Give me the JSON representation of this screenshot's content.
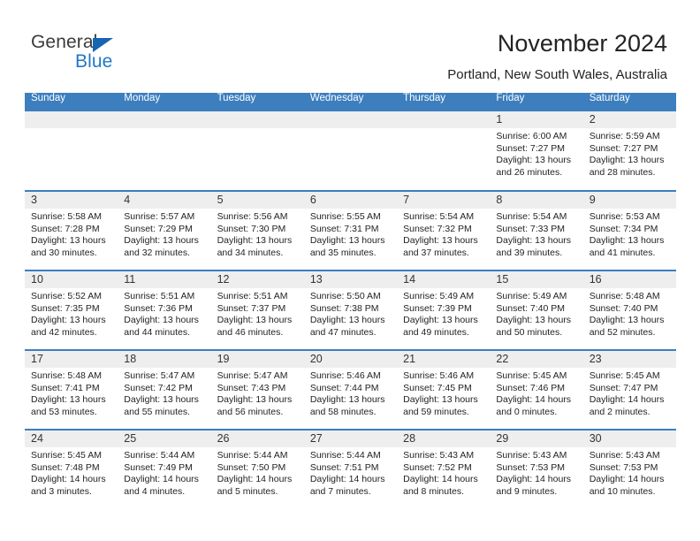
{
  "brand": {
    "name_part1": "General",
    "name_part2": "Blue",
    "triangle_color": "#1565b0",
    "blue_color": "#1f78c8"
  },
  "header": {
    "title": "November 2024",
    "subtitle": "Portland, New South Wales, Australia"
  },
  "theme": {
    "header_blue": "#3c7ebe",
    "daynum_strip": "#eeeeee",
    "text": "#232323"
  },
  "calendar": {
    "weekday_headers": [
      "Sunday",
      "Monday",
      "Tuesday",
      "Wednesday",
      "Thursday",
      "Friday",
      "Saturday"
    ],
    "weeks": [
      [
        {
          "day": "",
          "sunrise": "",
          "sunset": "",
          "daylight_line1": "",
          "daylight_line2": ""
        },
        {
          "day": "",
          "sunrise": "",
          "sunset": "",
          "daylight_line1": "",
          "daylight_line2": ""
        },
        {
          "day": "",
          "sunrise": "",
          "sunset": "",
          "daylight_line1": "",
          "daylight_line2": ""
        },
        {
          "day": "",
          "sunrise": "",
          "sunset": "",
          "daylight_line1": "",
          "daylight_line2": ""
        },
        {
          "day": "",
          "sunrise": "",
          "sunset": "",
          "daylight_line1": "",
          "daylight_line2": ""
        },
        {
          "day": "1",
          "sunrise": "Sunrise: 6:00 AM",
          "sunset": "Sunset: 7:27 PM",
          "daylight_line1": "Daylight: 13 hours",
          "daylight_line2": "and 26 minutes."
        },
        {
          "day": "2",
          "sunrise": "Sunrise: 5:59 AM",
          "sunset": "Sunset: 7:27 PM",
          "daylight_line1": "Daylight: 13 hours",
          "daylight_line2": "and 28 minutes."
        }
      ],
      [
        {
          "day": "3",
          "sunrise": "Sunrise: 5:58 AM",
          "sunset": "Sunset: 7:28 PM",
          "daylight_line1": "Daylight: 13 hours",
          "daylight_line2": "and 30 minutes."
        },
        {
          "day": "4",
          "sunrise": "Sunrise: 5:57 AM",
          "sunset": "Sunset: 7:29 PM",
          "daylight_line1": "Daylight: 13 hours",
          "daylight_line2": "and 32 minutes."
        },
        {
          "day": "5",
          "sunrise": "Sunrise: 5:56 AM",
          "sunset": "Sunset: 7:30 PM",
          "daylight_line1": "Daylight: 13 hours",
          "daylight_line2": "and 34 minutes."
        },
        {
          "day": "6",
          "sunrise": "Sunrise: 5:55 AM",
          "sunset": "Sunset: 7:31 PM",
          "daylight_line1": "Daylight: 13 hours",
          "daylight_line2": "and 35 minutes."
        },
        {
          "day": "7",
          "sunrise": "Sunrise: 5:54 AM",
          "sunset": "Sunset: 7:32 PM",
          "daylight_line1": "Daylight: 13 hours",
          "daylight_line2": "and 37 minutes."
        },
        {
          "day": "8",
          "sunrise": "Sunrise: 5:54 AM",
          "sunset": "Sunset: 7:33 PM",
          "daylight_line1": "Daylight: 13 hours",
          "daylight_line2": "and 39 minutes."
        },
        {
          "day": "9",
          "sunrise": "Sunrise: 5:53 AM",
          "sunset": "Sunset: 7:34 PM",
          "daylight_line1": "Daylight: 13 hours",
          "daylight_line2": "and 41 minutes."
        }
      ],
      [
        {
          "day": "10",
          "sunrise": "Sunrise: 5:52 AM",
          "sunset": "Sunset: 7:35 PM",
          "daylight_line1": "Daylight: 13 hours",
          "daylight_line2": "and 42 minutes."
        },
        {
          "day": "11",
          "sunrise": "Sunrise: 5:51 AM",
          "sunset": "Sunset: 7:36 PM",
          "daylight_line1": "Daylight: 13 hours",
          "daylight_line2": "and 44 minutes."
        },
        {
          "day": "12",
          "sunrise": "Sunrise: 5:51 AM",
          "sunset": "Sunset: 7:37 PM",
          "daylight_line1": "Daylight: 13 hours",
          "daylight_line2": "and 46 minutes."
        },
        {
          "day": "13",
          "sunrise": "Sunrise: 5:50 AM",
          "sunset": "Sunset: 7:38 PM",
          "daylight_line1": "Daylight: 13 hours",
          "daylight_line2": "and 47 minutes."
        },
        {
          "day": "14",
          "sunrise": "Sunrise: 5:49 AM",
          "sunset": "Sunset: 7:39 PM",
          "daylight_line1": "Daylight: 13 hours",
          "daylight_line2": "and 49 minutes."
        },
        {
          "day": "15",
          "sunrise": "Sunrise: 5:49 AM",
          "sunset": "Sunset: 7:40 PM",
          "daylight_line1": "Daylight: 13 hours",
          "daylight_line2": "and 50 minutes."
        },
        {
          "day": "16",
          "sunrise": "Sunrise: 5:48 AM",
          "sunset": "Sunset: 7:40 PM",
          "daylight_line1": "Daylight: 13 hours",
          "daylight_line2": "and 52 minutes."
        }
      ],
      [
        {
          "day": "17",
          "sunrise": "Sunrise: 5:48 AM",
          "sunset": "Sunset: 7:41 PM",
          "daylight_line1": "Daylight: 13 hours",
          "daylight_line2": "and 53 minutes."
        },
        {
          "day": "18",
          "sunrise": "Sunrise: 5:47 AM",
          "sunset": "Sunset: 7:42 PM",
          "daylight_line1": "Daylight: 13 hours",
          "daylight_line2": "and 55 minutes."
        },
        {
          "day": "19",
          "sunrise": "Sunrise: 5:47 AM",
          "sunset": "Sunset: 7:43 PM",
          "daylight_line1": "Daylight: 13 hours",
          "daylight_line2": "and 56 minutes."
        },
        {
          "day": "20",
          "sunrise": "Sunrise: 5:46 AM",
          "sunset": "Sunset: 7:44 PM",
          "daylight_line1": "Daylight: 13 hours",
          "daylight_line2": "and 58 minutes."
        },
        {
          "day": "21",
          "sunrise": "Sunrise: 5:46 AM",
          "sunset": "Sunset: 7:45 PM",
          "daylight_line1": "Daylight: 13 hours",
          "daylight_line2": "and 59 minutes."
        },
        {
          "day": "22",
          "sunrise": "Sunrise: 5:45 AM",
          "sunset": "Sunset: 7:46 PM",
          "daylight_line1": "Daylight: 14 hours",
          "daylight_line2": "and 0 minutes."
        },
        {
          "day": "23",
          "sunrise": "Sunrise: 5:45 AM",
          "sunset": "Sunset: 7:47 PM",
          "daylight_line1": "Daylight: 14 hours",
          "daylight_line2": "and 2 minutes."
        }
      ],
      [
        {
          "day": "24",
          "sunrise": "Sunrise: 5:45 AM",
          "sunset": "Sunset: 7:48 PM",
          "daylight_line1": "Daylight: 14 hours",
          "daylight_line2": "and 3 minutes."
        },
        {
          "day": "25",
          "sunrise": "Sunrise: 5:44 AM",
          "sunset": "Sunset: 7:49 PM",
          "daylight_line1": "Daylight: 14 hours",
          "daylight_line2": "and 4 minutes."
        },
        {
          "day": "26",
          "sunrise": "Sunrise: 5:44 AM",
          "sunset": "Sunset: 7:50 PM",
          "daylight_line1": "Daylight: 14 hours",
          "daylight_line2": "and 5 minutes."
        },
        {
          "day": "27",
          "sunrise": "Sunrise: 5:44 AM",
          "sunset": "Sunset: 7:51 PM",
          "daylight_line1": "Daylight: 14 hours",
          "daylight_line2": "and 7 minutes."
        },
        {
          "day": "28",
          "sunrise": "Sunrise: 5:43 AM",
          "sunset": "Sunset: 7:52 PM",
          "daylight_line1": "Daylight: 14 hours",
          "daylight_line2": "and 8 minutes."
        },
        {
          "day": "29",
          "sunrise": "Sunrise: 5:43 AM",
          "sunset": "Sunset: 7:53 PM",
          "daylight_line1": "Daylight: 14 hours",
          "daylight_line2": "and 9 minutes."
        },
        {
          "day": "30",
          "sunrise": "Sunrise: 5:43 AM",
          "sunset": "Sunset: 7:53 PM",
          "daylight_line1": "Daylight: 14 hours",
          "daylight_line2": "and 10 minutes."
        }
      ]
    ]
  }
}
